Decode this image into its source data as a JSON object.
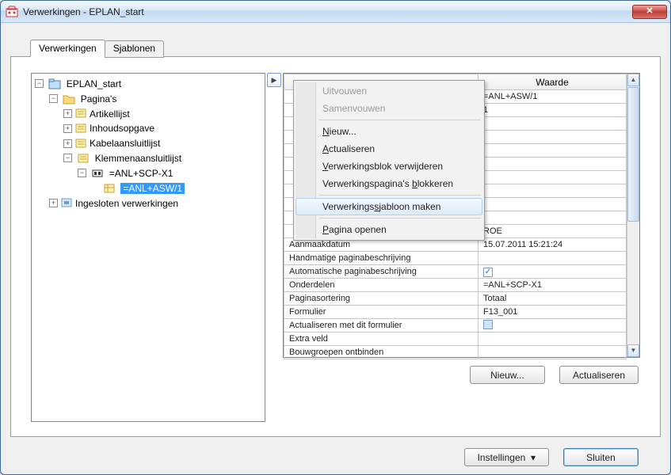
{
  "window_title": "Verwerkingen - EPLAN_start",
  "tabs": {
    "verwerkingen": "Verwerkingen",
    "sjablonen": "Sjablonen"
  },
  "tree": {
    "root": "EPLAN_start",
    "paginas": "Pagina's",
    "items": {
      "artikellijst": "Artikellijst",
      "inhoudsopgave": "Inhoudsopgave",
      "kabelaansluitlijst": "Kabelaansluitlijst",
      "klemmenaansluitlijst": "Klemmenaansluitlijst",
      "klemmen_child1": "=ANL+SCP-X1",
      "klemmen_child2": "=ANL+ASW/1",
      "ingesloten": "Ingesloten verwerkingen"
    }
  },
  "context_menu": {
    "uitvouwen": "Uitvouwen",
    "samenvouwen": "Samenvouwen",
    "nieuw": "Nieuw...",
    "actualiseren": "Actualiseren",
    "blok_verwijderen": "Verwerkingsblok verwijderen",
    "pag_blokkeren": "Verwerkingspagina's blokkeren",
    "sjabloon_maken": "Verwerkingssjabloon maken",
    "pagina_openen": "Pagina openen"
  },
  "table": {
    "col_waarde": "Waarde",
    "rows": [
      {
        "key": "",
        "value": "=ANL+ASW/1"
      },
      {
        "key": "",
        "value": "1"
      },
      {
        "key": "",
        "value": ""
      },
      {
        "key": "",
        "value": ""
      },
      {
        "key": "",
        "value": ""
      },
      {
        "key": "",
        "value": ""
      },
      {
        "key": "",
        "value": ""
      },
      {
        "key": "",
        "value": ""
      },
      {
        "key": "",
        "value": ""
      },
      {
        "key": "",
        "value": ""
      },
      {
        "key": "",
        "value": "ROE"
      },
      {
        "key": "Aanmaakdatum",
        "value": "15.07.2011 15:21:24"
      },
      {
        "key": "Handmatige paginabeschrijving",
        "value": ""
      },
      {
        "key": "Automatische paginabeschrijving",
        "value": "[check]"
      },
      {
        "key": "Onderdelen",
        "value": "=ANL+SCP-X1"
      },
      {
        "key": "Paginasortering",
        "value": "Totaal"
      },
      {
        "key": "Formulier",
        "value": "F13_001"
      },
      {
        "key": "Actualiseren met dit formulier",
        "value": "[box]"
      },
      {
        "key": "Extra veld",
        "value": ""
      },
      {
        "key": "Bouwgroepen ontbinden",
        "value": ""
      }
    ]
  },
  "buttons": {
    "nieuw": "Nieuw...",
    "actualiseren": "Actualiseren",
    "instellingen": "Instellingen",
    "sluiten": "Sluiten"
  }
}
